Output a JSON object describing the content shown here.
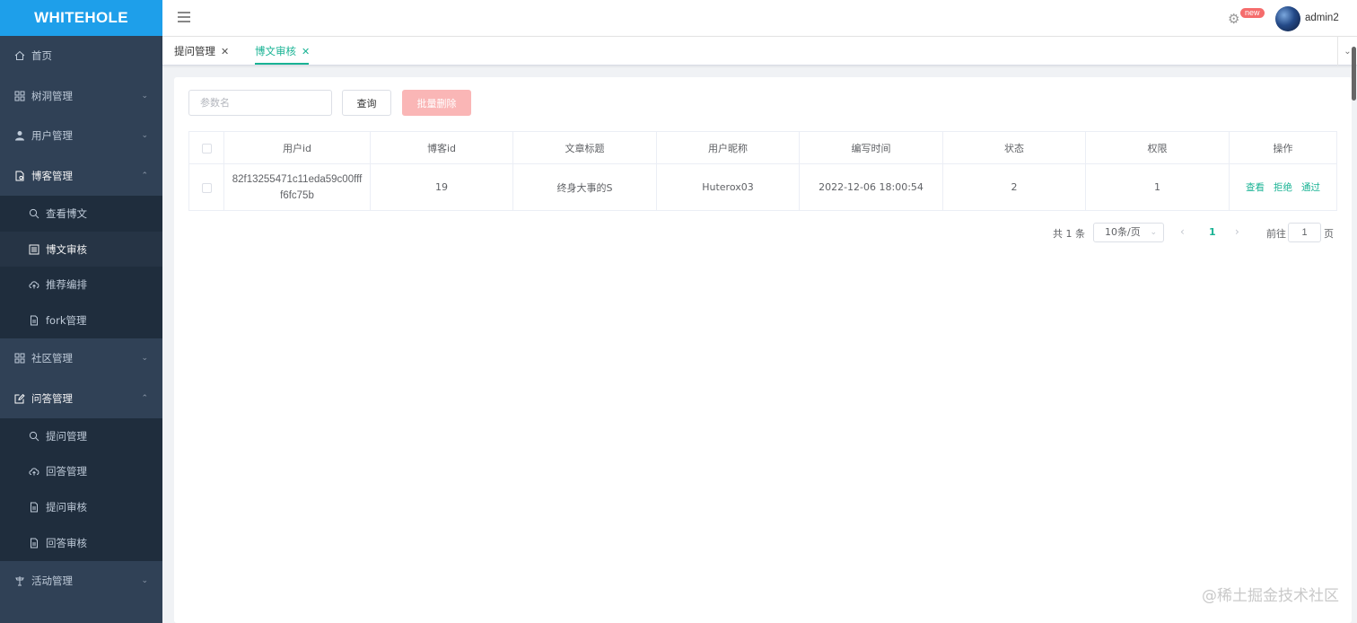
{
  "app": {
    "logo": "WHITEHOLE"
  },
  "sidebar": {
    "items": [
      {
        "label": "首页",
        "icon": "home-icon"
      },
      {
        "label": "树洞管理",
        "icon": "grid-icon"
      },
      {
        "label": "用户管理",
        "icon": "user-icon"
      },
      {
        "label": "博客管理",
        "icon": "document-icon",
        "children": [
          {
            "label": "查看博文",
            "icon": "search-icon"
          },
          {
            "label": "博文审核",
            "icon": "list-icon",
            "active": true
          },
          {
            "label": "推荐编排",
            "icon": "cloud-upload-icon"
          },
          {
            "label": "fork管理",
            "icon": "file-icon"
          }
        ]
      },
      {
        "label": "社区管理",
        "icon": "grid-icon"
      },
      {
        "label": "问答管理",
        "icon": "edit-icon",
        "children": [
          {
            "label": "提问管理",
            "icon": "search-icon"
          },
          {
            "label": "回答管理",
            "icon": "cloud-upload-icon"
          },
          {
            "label": "提问审核",
            "icon": "file-icon"
          },
          {
            "label": "回答审核",
            "icon": "file-icon"
          }
        ]
      },
      {
        "label": "活动管理",
        "icon": "flag-icon"
      }
    ]
  },
  "header": {
    "badge": "new",
    "username": "admin2"
  },
  "tags": [
    {
      "label": "提问管理",
      "active": false
    },
    {
      "label": "博文审核",
      "active": true
    }
  ],
  "toolbar": {
    "search_placeholder": "参数名",
    "query_label": "查询",
    "batch_delete_label": "批量删除"
  },
  "table": {
    "headers": [
      "用户id",
      "博客id",
      "文章标题",
      "用户昵称",
      "编写时间",
      "状态",
      "权限",
      "操作"
    ],
    "rows": [
      {
        "user_id": "82f13255471c11eda59c00ffff6fc75b",
        "blog_id": "19",
        "title": "终身大事的S",
        "nickname": "Huterox03",
        "time": "2022-12-06 18:00:54",
        "status": "2",
        "permission": "1",
        "actions": [
          "查看",
          "拒绝",
          "通过"
        ]
      }
    ]
  },
  "pagination": {
    "total": "共 1 条",
    "page_size": "10条/页",
    "current": "1",
    "goto_label": "前往",
    "goto_value": "1",
    "page_unit": "页"
  },
  "watermark": "@稀土掘金技术社区",
  "colors": {
    "accent": "#1ab394",
    "sidebar_bg": "#304156",
    "logo_bg": "#1e9fea",
    "danger_light": "#fab6b6",
    "badge": "#f56c6c"
  }
}
